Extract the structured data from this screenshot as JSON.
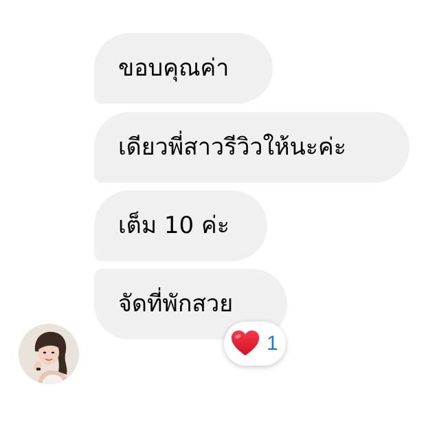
{
  "messages": [
    {
      "text": "ขอบคุณค่า"
    },
    {
      "text": "เดียวพี่สาวรีวิวให้นะค่ะ"
    },
    {
      "text": "เต็ม 10 ค่ะ"
    },
    {
      "text": "จัดที่พักสวย"
    }
  ],
  "reaction": {
    "icon": "heart-icon",
    "count": "1",
    "count_color": "#1877f2",
    "heart_color": "#e0202e"
  },
  "colors": {
    "bubble_bg": "#f0f0f0",
    "text": "#050505"
  }
}
